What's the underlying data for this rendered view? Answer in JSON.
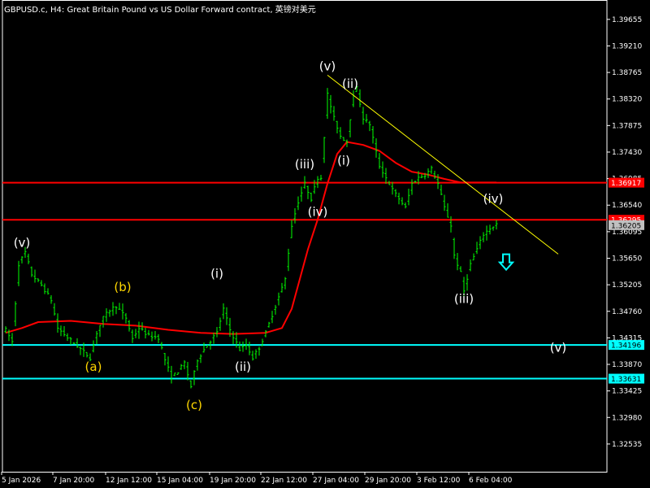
{
  "header": {
    "title": "GBPUSD.c, H4:  Great Britain Pound vs US Dollar Forward contract, 英镑对美元"
  },
  "colors": {
    "background": "#000000",
    "frame": "#ffffff",
    "candles": "#00ff00",
    "moving_average": "#ff0000",
    "horizontal_red": "#ff0000",
    "horizontal_cyan": "#00ffff",
    "trendline": "#ffff00",
    "wave_label_white": "#ffffff",
    "wave_label_yellow": "#ffd700",
    "arrow": "#00ffff",
    "badge_red": "#ff0000",
    "badge_grey": "#c0c0c0",
    "badge_cyan": "#00ffff",
    "axis_text": "#ffffff"
  },
  "chart_data": {
    "type": "candlestick",
    "symbol": "GBPUSD.c",
    "timeframe": "H4",
    "ylim": [
      1.3207,
      1.3998
    ],
    "y_ticks": [
      "1.39655",
      "1.39210",
      "1.38765",
      "1.38320",
      "1.37875",
      "1.37430",
      "1.36985",
      "1.36540",
      "1.36095",
      "1.35650",
      "1.35205",
      "1.34760",
      "1.34315",
      "1.33870",
      "1.33425",
      "1.32980",
      "1.32535"
    ],
    "x_tick_labels": [
      "5 Jan 2026",
      "7 Jan 20:00",
      "12 Jan 12:00",
      "15 Jan 04:00",
      "19 Jan 20:00",
      "22 Jan 12:00",
      "27 Jan 04:00",
      "29 Jan 20:00",
      "3 Feb 12:00",
      "6 Feb 04:00"
    ],
    "price_line_values": [
      {
        "label": "1.36917",
        "value": 1.36917,
        "style": "red"
      },
      {
        "label": "1.36295",
        "value": 1.36295,
        "style": "red"
      },
      {
        "label": "1.36205",
        "value": 1.36205,
        "style": "grey"
      },
      {
        "label": "1.34196",
        "value": 1.34196,
        "style": "cyan"
      },
      {
        "label": "1.33631",
        "value": 1.33631,
        "style": "cyan"
      }
    ],
    "horizontal_lines": [
      {
        "value": 1.36917,
        "color": "red"
      },
      {
        "value": 1.36295,
        "color": "red"
      },
      {
        "value": 1.34196,
        "color": "cyan"
      },
      {
        "value": 1.33631,
        "color": "cyan"
      }
    ],
    "trendline": {
      "from": {
        "bar": 99,
        "value": 1.3872
      },
      "to": {
        "bar": 170,
        "value": 1.3572
      }
    },
    "price_path": [
      [
        0,
        1.3445
      ],
      [
        2,
        1.3425
      ],
      [
        4,
        1.3555
      ],
      [
        6,
        1.3575
      ],
      [
        8,
        1.3538
      ],
      [
        11,
        1.352
      ],
      [
        14,
        1.3495
      ],
      [
        16,
        1.3448
      ],
      [
        19,
        1.3432
      ],
      [
        22,
        1.3418
      ],
      [
        26,
        1.3398
      ],
      [
        28,
        1.344
      ],
      [
        30,
        1.3465
      ],
      [
        32,
        1.3478
      ],
      [
        34,
        1.3485
      ],
      [
        37,
        1.3465
      ],
      [
        39,
        1.343
      ],
      [
        41,
        1.3448
      ],
      [
        44,
        1.3435
      ],
      [
        47,
        1.3432
      ],
      [
        49,
        1.3395
      ],
      [
        51,
        1.3365
      ],
      [
        53,
        1.3375
      ],
      [
        55,
        1.339
      ],
      [
        57,
        1.335
      ],
      [
        59,
        1.3395
      ],
      [
        62,
        1.342
      ],
      [
        65,
        1.344
      ],
      [
        67,
        1.348
      ],
      [
        69,
        1.3445
      ],
      [
        72,
        1.3412
      ],
      [
        74,
        1.342
      ],
      [
        76,
        1.3398
      ],
      [
        78,
        1.3415
      ],
      [
        80,
        1.344
      ],
      [
        82,
        1.347
      ],
      [
        84,
        1.35
      ],
      [
        86,
        1.353
      ],
      [
        88,
        1.362
      ],
      [
        90,
        1.366
      ],
      [
        92,
        1.369
      ],
      [
        94,
        1.3665
      ],
      [
        96,
        1.37
      ],
      [
        97,
        1.37
      ],
      [
        99,
        1.384
      ],
      [
        101,
        1.38
      ],
      [
        103,
        1.377
      ],
      [
        105,
        1.376
      ],
      [
        107,
        1.384
      ],
      [
        108,
        1.385
      ],
      [
        110,
        1.38
      ],
      [
        112,
        1.379
      ],
      [
        115,
        1.372
      ],
      [
        117,
        1.37
      ],
      [
        119,
        1.368
      ],
      [
        121,
        1.3665
      ],
      [
        123,
        1.365
      ],
      [
        125,
        1.369
      ],
      [
        127,
        1.37
      ],
      [
        129,
        1.3705
      ],
      [
        131,
        1.3715
      ],
      [
        133,
        1.369
      ],
      [
        135,
        1.365
      ],
      [
        137,
        1.362
      ],
      [
        138,
        1.357
      ],
      [
        140,
        1.354
      ],
      [
        141,
        1.351
      ],
      [
        143,
        1.3555
      ],
      [
        145,
        1.358
      ],
      [
        147,
        1.3605
      ],
      [
        149,
        1.3615
      ],
      [
        151,
        1.3622
      ]
    ],
    "moving_average_path": [
      [
        0,
        1.344
      ],
      [
        5,
        1.3448
      ],
      [
        10,
        1.3458
      ],
      [
        20,
        1.346
      ],
      [
        30,
        1.3455
      ],
      [
        40,
        1.3452
      ],
      [
        50,
        1.3445
      ],
      [
        60,
        1.344
      ],
      [
        70,
        1.3438
      ],
      [
        80,
        1.344
      ],
      [
        85,
        1.3448
      ],
      [
        88,
        1.348
      ],
      [
        90,
        1.352
      ],
      [
        93,
        1.358
      ],
      [
        96,
        1.363
      ],
      [
        99,
        1.369
      ],
      [
        102,
        1.374
      ],
      [
        105,
        1.376
      ],
      [
        110,
        1.3755
      ],
      [
        115,
        1.3745
      ],
      [
        120,
        1.3725
      ],
      [
        125,
        1.371
      ],
      [
        130,
        1.3705
      ],
      [
        135,
        1.3698
      ],
      [
        140,
        1.3692
      ],
      [
        145,
        1.3692
      ],
      [
        151,
        1.3692
      ]
    ],
    "wave_labels": [
      {
        "text": "(v)",
        "bar": 5,
        "value": 1.3584,
        "color": "white"
      },
      {
        "text": "(a)",
        "bar": 27,
        "value": 1.3376,
        "color": "yellow"
      },
      {
        "text": "(b)",
        "bar": 36,
        "value": 1.351,
        "color": "yellow"
      },
      {
        "text": "(c)",
        "bar": 58,
        "value": 1.3312,
        "color": "yellow"
      },
      {
        "text": "(i)",
        "bar": 65,
        "value": 1.3532,
        "color": "white"
      },
      {
        "text": "(ii)",
        "bar": 73,
        "value": 1.3376,
        "color": "white"
      },
      {
        "text": "(iii)",
        "bar": 92,
        "value": 1.3716,
        "color": "white"
      },
      {
        "text": "(iv)",
        "bar": 96,
        "value": 1.3636,
        "color": "white"
      },
      {
        "text": "(v)",
        "bar": 99,
        "value": 1.388,
        "color": "white"
      },
      {
        "text": "(ii)",
        "bar": 106,
        "value": 1.3851,
        "color": "white"
      },
      {
        "text": "(i)",
        "bar": 104,
        "value": 1.3722,
        "color": "white"
      },
      {
        "text": "(iii)",
        "bar": 141,
        "value": 1.349,
        "color": "white"
      },
      {
        "text": "(iv)",
        "bar": 150,
        "value": 1.3658,
        "color": "white"
      },
      {
        "text": "(v)",
        "bar": 170,
        "value": 1.3408,
        "color": "white"
      }
    ],
    "arrow": {
      "direction": "down",
      "bar": 154,
      "value": 1.3558
    }
  }
}
